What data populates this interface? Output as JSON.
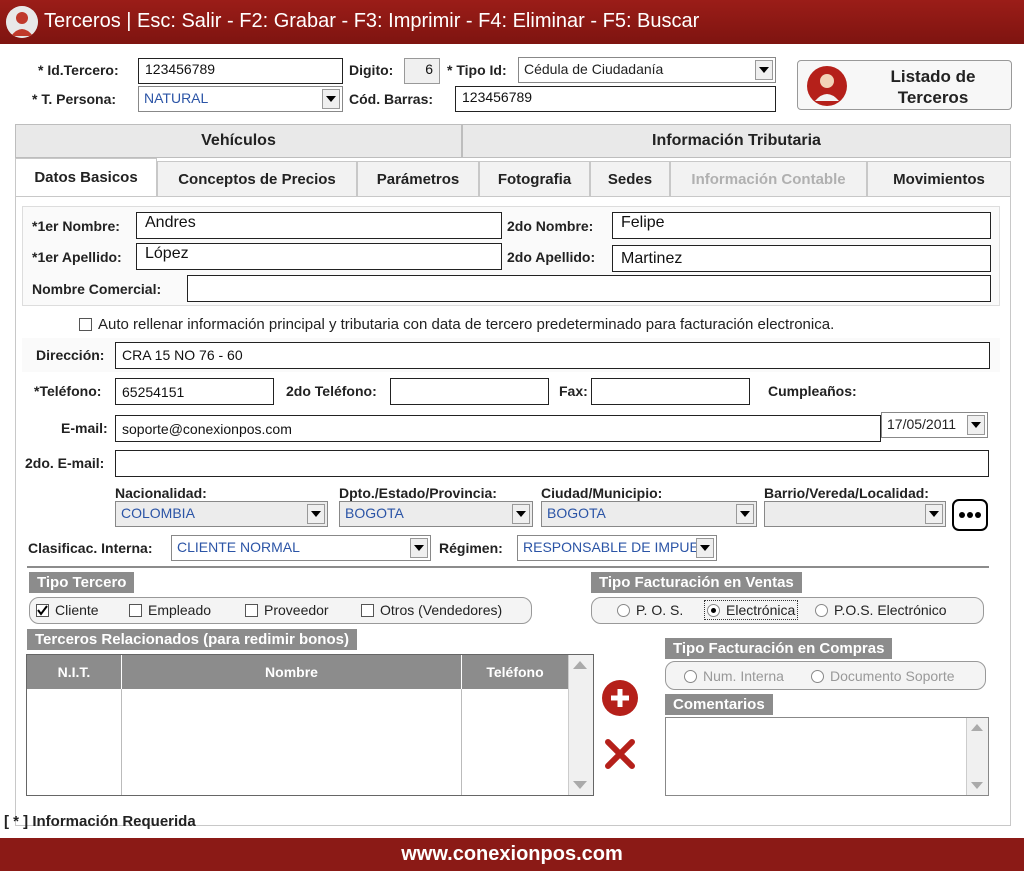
{
  "window": {
    "title": "Terceros   |   Esc: Salir - F2: Grabar - F3: Imprimir - F4: Eliminar - F5: Buscar"
  },
  "header": {
    "id_label": "* Id.Tercero:",
    "id_value": "123456789",
    "digito_label": "Digito:",
    "digito_value": "6",
    "tipo_id_label": "* Tipo Id:",
    "tipo_id_value": "Cédula de Ciudadanía",
    "persona_label": "* T. Persona:",
    "persona_value": "NATURAL",
    "barras_label": "Cód. Barras:",
    "barras_value": "123456789",
    "listado_button": "Listado de Terceros"
  },
  "top_tabs": [
    "Vehículos",
    "Información Tributaria"
  ],
  "tabs": [
    "Datos Basicos",
    "Conceptos de Precios",
    "Parámetros",
    "Fotografia",
    "Sedes",
    "Información Contable",
    "Movimientos"
  ],
  "names": {
    "nombre1_label": "*1er Nombre:",
    "nombre1_value": "Andres",
    "nombre2_label": "2do Nombre:",
    "nombre2_value": "Felipe",
    "apellido1_label": "*1er Apellido:",
    "apellido1_value": "López",
    "apellido2_label": "2do Apellido:",
    "apellido2_value": "Martinez",
    "comercial_label": "Nombre Comercial:",
    "comercial_value": ""
  },
  "autofill_label": "Auto rellenar información principal y tributaria con data de tercero predeterminado para facturación electronica.",
  "contact": {
    "direccion_label": "Dirección:",
    "direccion_value": "CRA 15 NO 76 - 60",
    "telefono_label": "*Teléfono:",
    "telefono_value": "65254151",
    "telefono2_label": "2do Teléfono:",
    "telefono2_value": "",
    "fax_label": "Fax:",
    "fax_value": "",
    "cumple_label": "Cumpleaños:",
    "cumple_value": "17/05/2011",
    "email_label": "E-mail:",
    "email_value": "soporte@conexionpos.com",
    "email2_label": "2do. E-mail:",
    "email2_value": ""
  },
  "location": {
    "nacionalidad_label": "Nacionalidad:",
    "nacionalidad_value": "COLOMBIA",
    "dpto_label": "Dpto./Estado/Provincia:",
    "dpto_value": "BOGOTA",
    "ciudad_label": "Ciudad/Municipio:",
    "ciudad_value": "BOGOTA",
    "barrio_label": "Barrio/Vereda/Localidad:",
    "barrio_value": ""
  },
  "clasif": {
    "label": "Clasificac. Interna:",
    "value": "CLIENTE NORMAL",
    "regimen_label": "Régimen:",
    "regimen_value": "RESPONSABLE DE IMPUE"
  },
  "tipo_tercero": {
    "title": "Tipo Tercero",
    "options": [
      "Cliente",
      "Empleado",
      "Proveedor",
      "Otros (Vendedores)"
    ],
    "checked": [
      true,
      false,
      false,
      false
    ]
  },
  "tipo_fact_ventas": {
    "title": "Tipo Facturación en Ventas",
    "options": [
      "P. O. S.",
      "Electrónica",
      "P.O.S. Electrónico"
    ],
    "selected": "Electrónica"
  },
  "relacionados": {
    "title": "Terceros Relacionados (para redimir bonos)",
    "columns": [
      "N.I.T.",
      "Nombre",
      "Teléfono"
    ]
  },
  "tipo_fact_compras": {
    "title": "Tipo Facturación en Compras",
    "options": [
      "Num. Interna",
      "Documento Soporte"
    ]
  },
  "comentarios": {
    "title": "Comentarios",
    "value": ""
  },
  "required_note": "[ * ] Información Requerida",
  "footer": "www.conexionpos.com",
  "colors": {
    "title_bar": "#8b1a16",
    "accent_red": "#b5201a",
    "value_blue": "#2b54a6"
  },
  "icons": [
    "user-avatar-icon",
    "add-icon",
    "delete-icon",
    "more-icon",
    "dropdown-arrow-icon"
  ]
}
